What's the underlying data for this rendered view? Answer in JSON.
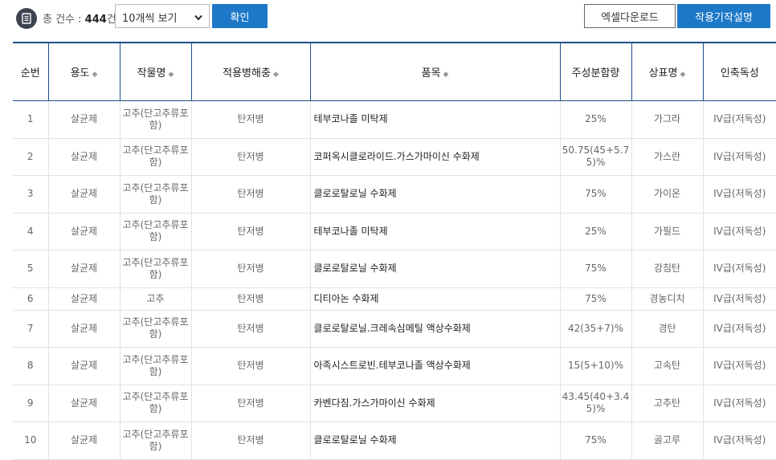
{
  "toolbar": {
    "total_prefix": "총 건수 : ",
    "total_count": "444",
    "total_suffix": "건",
    "per_page_selected": "10개씩 보기",
    "confirm_label": "확인",
    "excel_label": "엑셀다운로드",
    "guide_label": "작용기작설명"
  },
  "icons": {
    "document": "document-icon",
    "dropdown": "chevron-down-icon",
    "sort": "sort-icon"
  },
  "colors": {
    "primary": "#1d78c8",
    "header_border": "#1d4f8a",
    "icon_bg": "#3d4450"
  },
  "table": {
    "columns": [
      {
        "label": "순번",
        "sortable": false
      },
      {
        "label": "용도",
        "sortable": true
      },
      {
        "label": "작물명",
        "sortable": true
      },
      {
        "label": "적용병해충",
        "sortable": true
      },
      {
        "label": "품목",
        "sortable": true
      },
      {
        "label": "주성분함량",
        "sortable": false
      },
      {
        "label": "상표명",
        "sortable": true
      },
      {
        "label": "인축독성",
        "sortable": false
      }
    ],
    "rows": [
      {
        "no": "1",
        "use": "살균제",
        "crop": "고추(단고추류포함)",
        "pest": "탄저병",
        "product": "테부코나졸 미탁제",
        "content": "25%",
        "brand": "가그라",
        "toxicity": "IV급(저독성)"
      },
      {
        "no": "2",
        "use": "살균제",
        "crop": "고추(단고추류포함)",
        "pest": "탄저병",
        "product": "코퍼옥시클로라이드.가스가마이신 수화제",
        "content": "50.75(45+5.75)%",
        "brand": "가스란",
        "toxicity": "IV급(저독성)"
      },
      {
        "no": "3",
        "use": "살균제",
        "crop": "고추(단고추류포함)",
        "pest": "탄저병",
        "product": "클로로탈로닐 수화제",
        "content": "75%",
        "brand": "가이온",
        "toxicity": "IV급(저독성)"
      },
      {
        "no": "4",
        "use": "살균제",
        "crop": "고추(단고추류포함)",
        "pest": "탄저병",
        "product": "테부코나졸 미탁제",
        "content": "25%",
        "brand": "가필드",
        "toxicity": "IV급(저독성)"
      },
      {
        "no": "5",
        "use": "살균제",
        "crop": "고추(단고추류포함)",
        "pest": "탄저병",
        "product": "클로로탈로닐 수화제",
        "content": "75%",
        "brand": "강침탄",
        "toxicity": "IV급(저독성)"
      },
      {
        "no": "6",
        "use": "살균제",
        "crop": "고추",
        "pest": "탄저병",
        "product": "디티아논 수화제",
        "content": "75%",
        "brand": "경농디치",
        "toxicity": "IV급(저독성)"
      },
      {
        "no": "7",
        "use": "살균제",
        "crop": "고추(단고추류포함)",
        "pest": "탄저병",
        "product": "클로로탈로닐.크레속심메틸 액상수화제",
        "content": "42(35+7)%",
        "brand": "경탄",
        "toxicity": "IV급(저독성)"
      },
      {
        "no": "8",
        "use": "살균제",
        "crop": "고추(단고추류포함)",
        "pest": "탄저병",
        "product": "아족시스트로빈.테부코나졸 액상수화제",
        "content": "15(5+10)%",
        "brand": "고속탄",
        "toxicity": "IV급(저독성)"
      },
      {
        "no": "9",
        "use": "살균제",
        "crop": "고추(단고추류포함)",
        "pest": "탄저병",
        "product": "카벤다짐.가스가마이신 수화제",
        "content": "43.45(40+3.45)%",
        "brand": "고추탄",
        "toxicity": "IV급(저독성)"
      },
      {
        "no": "10",
        "use": "살균제",
        "crop": "고추(단고추류포함)",
        "pest": "탄저병",
        "product": "클로로탈로닐 수화제",
        "content": "75%",
        "brand": "골고루",
        "toxicity": "IV급(저독성)"
      }
    ]
  }
}
